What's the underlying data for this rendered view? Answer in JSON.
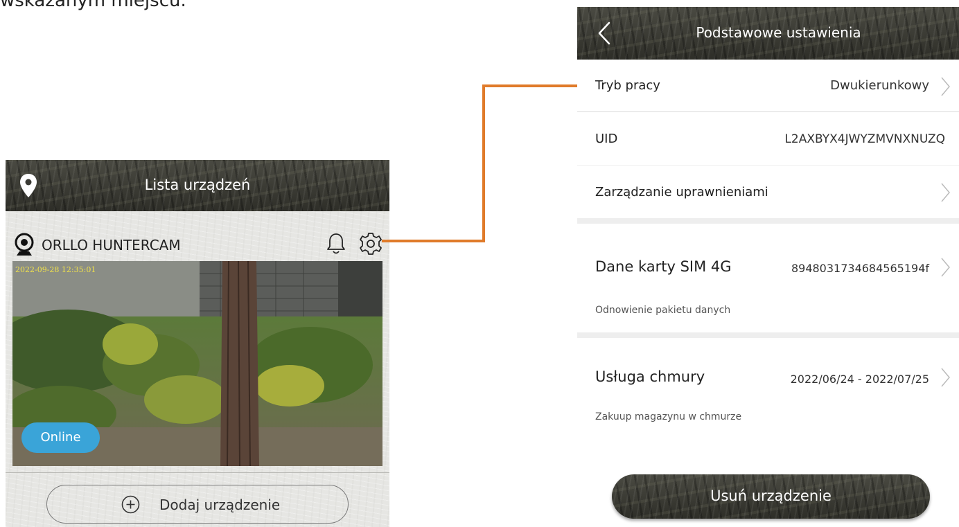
{
  "top_text": "wskazanym miejscu.",
  "left_screen": {
    "title": "Lista urządzeń",
    "device_name": "ORLLO HUNTERCAM",
    "timestamp": "2022-09-28 12:35:01",
    "status": "Online",
    "add_device_label": "Dodaj urządzenie"
  },
  "right_screen": {
    "title": "Podstawowe ustawienia",
    "work_mode": {
      "label": "Tryb pracy",
      "value": "Dwukierunkowy"
    },
    "uid": {
      "label": "UID",
      "value": "L2AXBYX4JWYZMVNXNUZQ"
    },
    "permissions": {
      "label": "Zarządzanie uprawnieniami"
    },
    "sim": {
      "label": "Dane karty SIM 4G",
      "value": "89480317346845651​94f",
      "sub": "Odnowienie pakietu danych"
    },
    "cloud": {
      "label": "Usługa chmury",
      "value": "2022/06/24 - 2022/07/25",
      "sub": "Zakuup magazynu w chmurze"
    },
    "delete_label": "Usuń urządzenie"
  },
  "colors": {
    "connector": "#e07b2a",
    "online_badge": "#3aa4d8",
    "timestamp": "#f2e34a"
  }
}
